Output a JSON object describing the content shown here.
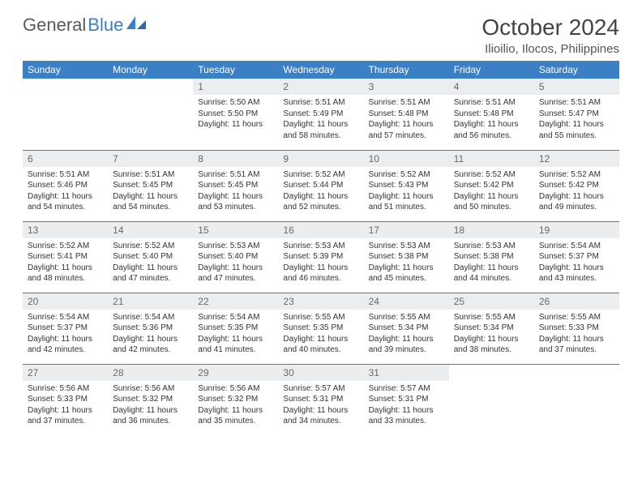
{
  "brand": {
    "part1": "General",
    "part2": "Blue"
  },
  "title": "October 2024",
  "location": "Ilioilio, Ilocos, Philippines",
  "weekdays": [
    "Sunday",
    "Monday",
    "Tuesday",
    "Wednesday",
    "Thursday",
    "Friday",
    "Saturday"
  ],
  "weeks": [
    [
      null,
      null,
      {
        "n": "1",
        "sr": "5:50 AM",
        "ss": "5:50 PM",
        "dl": "11 hours",
        "dm": ""
      },
      {
        "n": "2",
        "sr": "5:51 AM",
        "ss": "5:49 PM",
        "dl": "11 hours",
        "dm": "and 58 minutes."
      },
      {
        "n": "3",
        "sr": "5:51 AM",
        "ss": "5:48 PM",
        "dl": "11 hours",
        "dm": "and 57 minutes."
      },
      {
        "n": "4",
        "sr": "5:51 AM",
        "ss": "5:48 PM",
        "dl": "11 hours",
        "dm": "and 56 minutes."
      },
      {
        "n": "5",
        "sr": "5:51 AM",
        "ss": "5:47 PM",
        "dl": "11 hours",
        "dm": "and 55 minutes."
      }
    ],
    [
      {
        "n": "6",
        "sr": "5:51 AM",
        "ss": "5:46 PM",
        "dl": "11 hours",
        "dm": "and 54 minutes."
      },
      {
        "n": "7",
        "sr": "5:51 AM",
        "ss": "5:45 PM",
        "dl": "11 hours",
        "dm": "and 54 minutes."
      },
      {
        "n": "8",
        "sr": "5:51 AM",
        "ss": "5:45 PM",
        "dl": "11 hours",
        "dm": "and 53 minutes."
      },
      {
        "n": "9",
        "sr": "5:52 AM",
        "ss": "5:44 PM",
        "dl": "11 hours",
        "dm": "and 52 minutes."
      },
      {
        "n": "10",
        "sr": "5:52 AM",
        "ss": "5:43 PM",
        "dl": "11 hours",
        "dm": "and 51 minutes."
      },
      {
        "n": "11",
        "sr": "5:52 AM",
        "ss": "5:42 PM",
        "dl": "11 hours",
        "dm": "and 50 minutes."
      },
      {
        "n": "12",
        "sr": "5:52 AM",
        "ss": "5:42 PM",
        "dl": "11 hours",
        "dm": "and 49 minutes."
      }
    ],
    [
      {
        "n": "13",
        "sr": "5:52 AM",
        "ss": "5:41 PM",
        "dl": "11 hours",
        "dm": "and 48 minutes."
      },
      {
        "n": "14",
        "sr": "5:52 AM",
        "ss": "5:40 PM",
        "dl": "11 hours",
        "dm": "and 47 minutes."
      },
      {
        "n": "15",
        "sr": "5:53 AM",
        "ss": "5:40 PM",
        "dl": "11 hours",
        "dm": "and 47 minutes."
      },
      {
        "n": "16",
        "sr": "5:53 AM",
        "ss": "5:39 PM",
        "dl": "11 hours",
        "dm": "and 46 minutes."
      },
      {
        "n": "17",
        "sr": "5:53 AM",
        "ss": "5:38 PM",
        "dl": "11 hours",
        "dm": "and 45 minutes."
      },
      {
        "n": "18",
        "sr": "5:53 AM",
        "ss": "5:38 PM",
        "dl": "11 hours",
        "dm": "and 44 minutes."
      },
      {
        "n": "19",
        "sr": "5:54 AM",
        "ss": "5:37 PM",
        "dl": "11 hours",
        "dm": "and 43 minutes."
      }
    ],
    [
      {
        "n": "20",
        "sr": "5:54 AM",
        "ss": "5:37 PM",
        "dl": "11 hours",
        "dm": "and 42 minutes."
      },
      {
        "n": "21",
        "sr": "5:54 AM",
        "ss": "5:36 PM",
        "dl": "11 hours",
        "dm": "and 42 minutes."
      },
      {
        "n": "22",
        "sr": "5:54 AM",
        "ss": "5:35 PM",
        "dl": "11 hours",
        "dm": "and 41 minutes."
      },
      {
        "n": "23",
        "sr": "5:55 AM",
        "ss": "5:35 PM",
        "dl": "11 hours",
        "dm": "and 40 minutes."
      },
      {
        "n": "24",
        "sr": "5:55 AM",
        "ss": "5:34 PM",
        "dl": "11 hours",
        "dm": "and 39 minutes."
      },
      {
        "n": "25",
        "sr": "5:55 AM",
        "ss": "5:34 PM",
        "dl": "11 hours",
        "dm": "and 38 minutes."
      },
      {
        "n": "26",
        "sr": "5:55 AM",
        "ss": "5:33 PM",
        "dl": "11 hours",
        "dm": "and 37 minutes."
      }
    ],
    [
      {
        "n": "27",
        "sr": "5:56 AM",
        "ss": "5:33 PM",
        "dl": "11 hours",
        "dm": "and 37 minutes."
      },
      {
        "n": "28",
        "sr": "5:56 AM",
        "ss": "5:32 PM",
        "dl": "11 hours",
        "dm": "and 36 minutes."
      },
      {
        "n": "29",
        "sr": "5:56 AM",
        "ss": "5:32 PM",
        "dl": "11 hours",
        "dm": "and 35 minutes."
      },
      {
        "n": "30",
        "sr": "5:57 AM",
        "ss": "5:31 PM",
        "dl": "11 hours",
        "dm": "and 34 minutes."
      },
      {
        "n": "31",
        "sr": "5:57 AM",
        "ss": "5:31 PM",
        "dl": "11 hours",
        "dm": "and 33 minutes."
      },
      null,
      null
    ]
  ],
  "labels": {
    "sunrise": "Sunrise:",
    "sunset": "Sunset:",
    "daylight": "Daylight:"
  }
}
